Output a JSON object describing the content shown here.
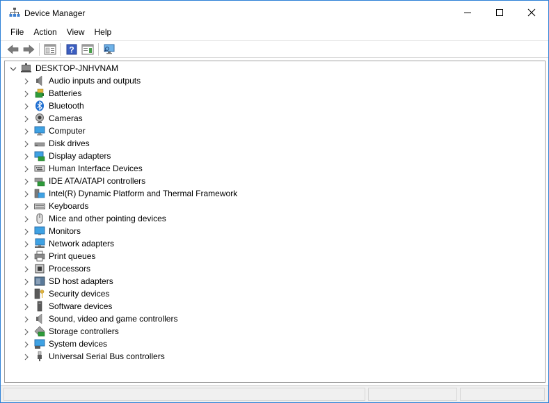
{
  "window": {
    "title": "Device Manager",
    "accent": "#2b7fd6"
  },
  "menu": {
    "items": [
      {
        "label": "File"
      },
      {
        "label": "Action"
      },
      {
        "label": "View"
      },
      {
        "label": "Help"
      }
    ]
  },
  "toolbar": {
    "buttons": [
      {
        "icon": "back-arrow-icon"
      },
      {
        "icon": "forward-arrow-icon"
      },
      {
        "icon": "properties-icon"
      },
      {
        "icon": "help-icon"
      },
      {
        "icon": "action-pane-icon"
      },
      {
        "icon": "monitor-scan-icon"
      }
    ]
  },
  "tree": {
    "root": {
      "label": "DESKTOP-JNHVNAM",
      "expanded": true
    },
    "items": [
      {
        "label": "Audio inputs and outputs",
        "icon": "speaker-icon"
      },
      {
        "label": "Batteries",
        "icon": "battery-icon"
      },
      {
        "label": "Bluetooth",
        "icon": "bluetooth-icon"
      },
      {
        "label": "Cameras",
        "icon": "camera-icon"
      },
      {
        "label": "Computer",
        "icon": "computer-icon"
      },
      {
        "label": "Disk drives",
        "icon": "disk-drive-icon"
      },
      {
        "label": "Display adapters",
        "icon": "display-adapter-icon"
      },
      {
        "label": "Human Interface Devices",
        "icon": "hid-icon"
      },
      {
        "label": "IDE ATA/ATAPI controllers",
        "icon": "ide-controller-icon"
      },
      {
        "label": "Intel(R) Dynamic Platform and Thermal Framework",
        "icon": "thermal-framework-icon"
      },
      {
        "label": "Keyboards",
        "icon": "keyboard-icon"
      },
      {
        "label": "Mice and other pointing devices",
        "icon": "mouse-icon"
      },
      {
        "label": "Monitors",
        "icon": "monitor-icon"
      },
      {
        "label": "Network adapters",
        "icon": "network-adapter-icon"
      },
      {
        "label": "Print queues",
        "icon": "printer-icon"
      },
      {
        "label": "Processors",
        "icon": "processor-icon"
      },
      {
        "label": "SD host adapters",
        "icon": "sd-card-icon"
      },
      {
        "label": "Security devices",
        "icon": "security-key-icon"
      },
      {
        "label": "Software devices",
        "icon": "software-device-icon"
      },
      {
        "label": "Sound, video and game controllers",
        "icon": "sound-controller-icon"
      },
      {
        "label": "Storage controllers",
        "icon": "storage-controller-icon"
      },
      {
        "label": "System devices",
        "icon": "system-device-icon"
      },
      {
        "label": "Universal Serial Bus controllers",
        "icon": "usb-icon"
      }
    ]
  }
}
